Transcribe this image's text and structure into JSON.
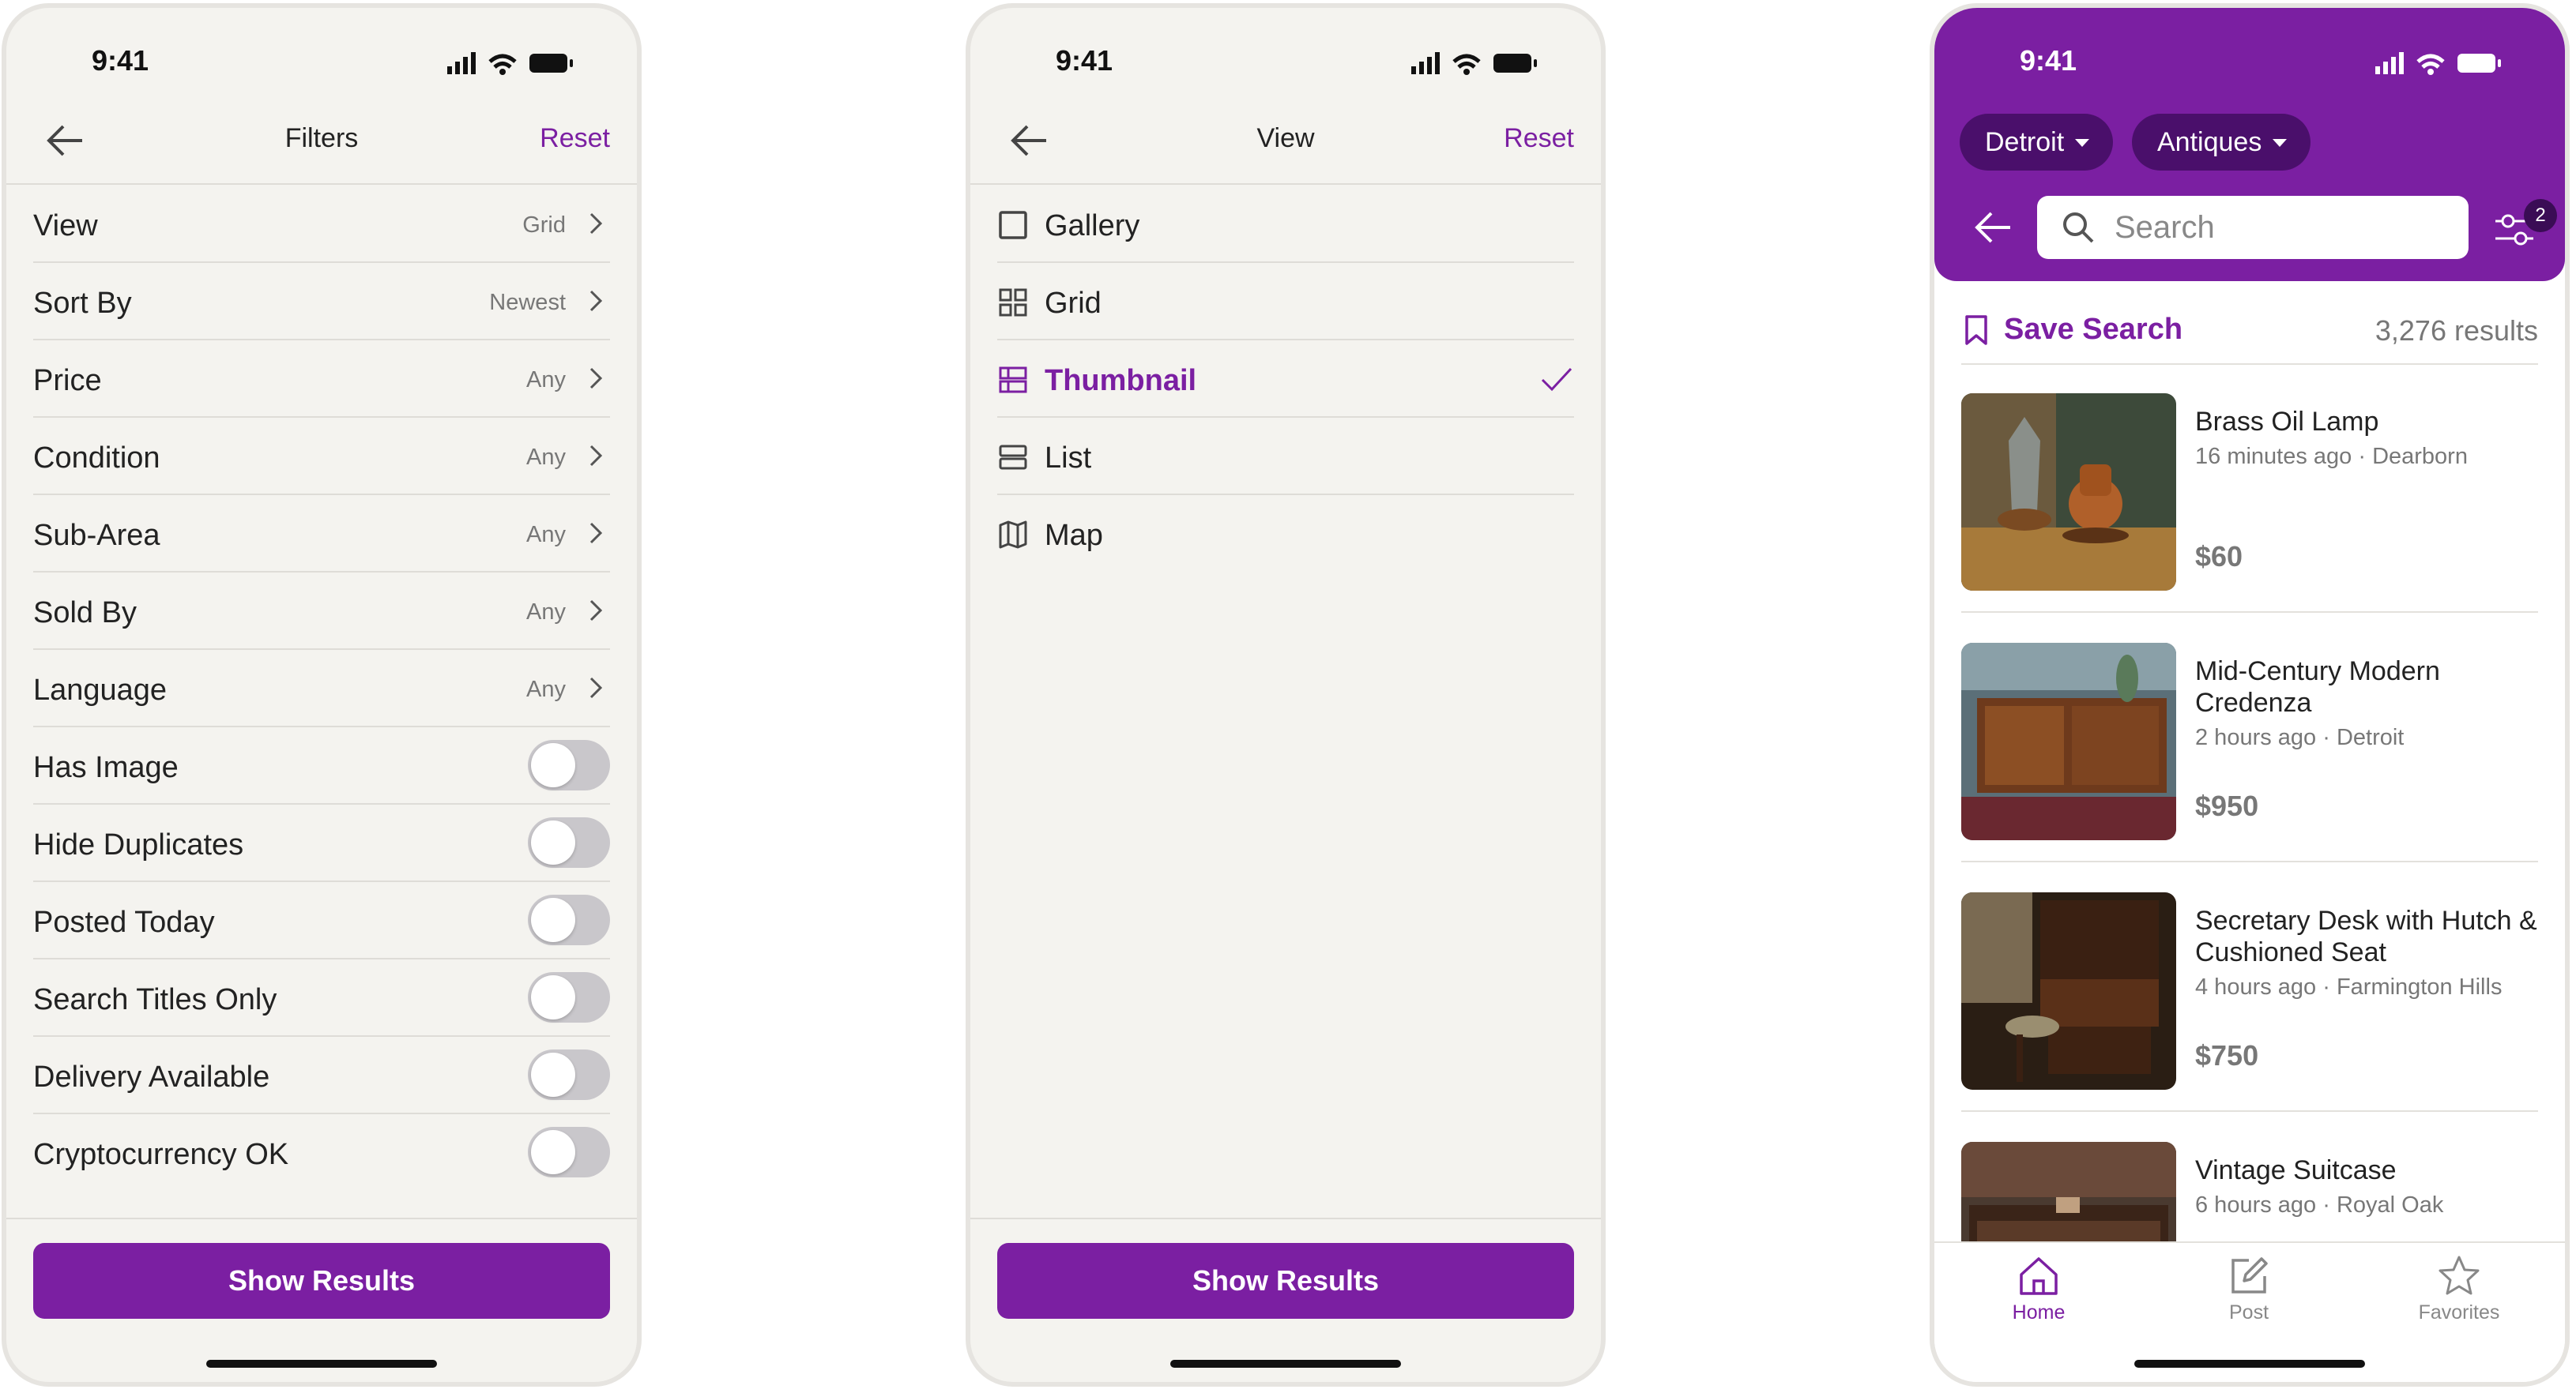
{
  "status": {
    "time": "9:41"
  },
  "colors": {
    "accent": "#7b1fa2",
    "chip": "#4a0f6b",
    "toggle_off": "#c9c7cb",
    "background": "#f4f3ef"
  },
  "filters_screen": {
    "title": "Filters",
    "reset": "Reset",
    "nav_rows": [
      {
        "label": "View",
        "value": "Grid"
      },
      {
        "label": "Sort By",
        "value": "Newest"
      },
      {
        "label": "Price",
        "value": "Any"
      },
      {
        "label": "Condition",
        "value": "Any"
      },
      {
        "label": "Sub-Area",
        "value": "Any"
      },
      {
        "label": "Sold By",
        "value": "Any"
      },
      {
        "label": "Language",
        "value": "Any"
      }
    ],
    "toggle_rows": [
      {
        "label": "Has Image",
        "on": false
      },
      {
        "label": "Hide Duplicates",
        "on": false
      },
      {
        "label": "Posted Today",
        "on": false
      },
      {
        "label": "Search Titles Only",
        "on": false
      },
      {
        "label": "Delivery Available",
        "on": false
      },
      {
        "label": "Cryptocurrency OK",
        "on": false
      }
    ],
    "button": "Show Results"
  },
  "view_screen": {
    "title": "View",
    "reset": "Reset",
    "options": [
      {
        "label": "Gallery",
        "icon": "square-icon",
        "selected": false
      },
      {
        "label": "Grid",
        "icon": "grid-icon",
        "selected": false
      },
      {
        "label": "Thumbnail",
        "icon": "thumbnail-icon",
        "selected": true
      },
      {
        "label": "List",
        "icon": "list-icon",
        "selected": false
      },
      {
        "label": "Map",
        "icon": "map-icon",
        "selected": false
      }
    ],
    "button": "Show Results"
  },
  "results_screen": {
    "chips": [
      "Detroit",
      "Antiques"
    ],
    "search_placeholder": "Search",
    "filter_badge": "2",
    "save_search": "Save Search",
    "results_count": "3,276 results",
    "listings": [
      {
        "title": "Brass Oil Lamp",
        "meta": "16 minutes ago · Dearborn",
        "price": "$60"
      },
      {
        "title": "Mid-Century Modern Credenza",
        "meta": "2 hours ago · Detroit",
        "price": "$950"
      },
      {
        "title": "Secretary Desk with Hutch & Cushioned Seat",
        "meta": "4 hours ago · Farmington Hills",
        "price": "$750"
      },
      {
        "title": "Vintage Suitcase",
        "meta": "6 hours ago · Royal Oak",
        "price": ""
      }
    ],
    "tabs": [
      {
        "label": "Home",
        "icon": "home-icon",
        "active": true
      },
      {
        "label": "Post",
        "icon": "edit-icon",
        "active": false
      },
      {
        "label": "Favorites",
        "icon": "star-icon",
        "active": false
      }
    ]
  }
}
